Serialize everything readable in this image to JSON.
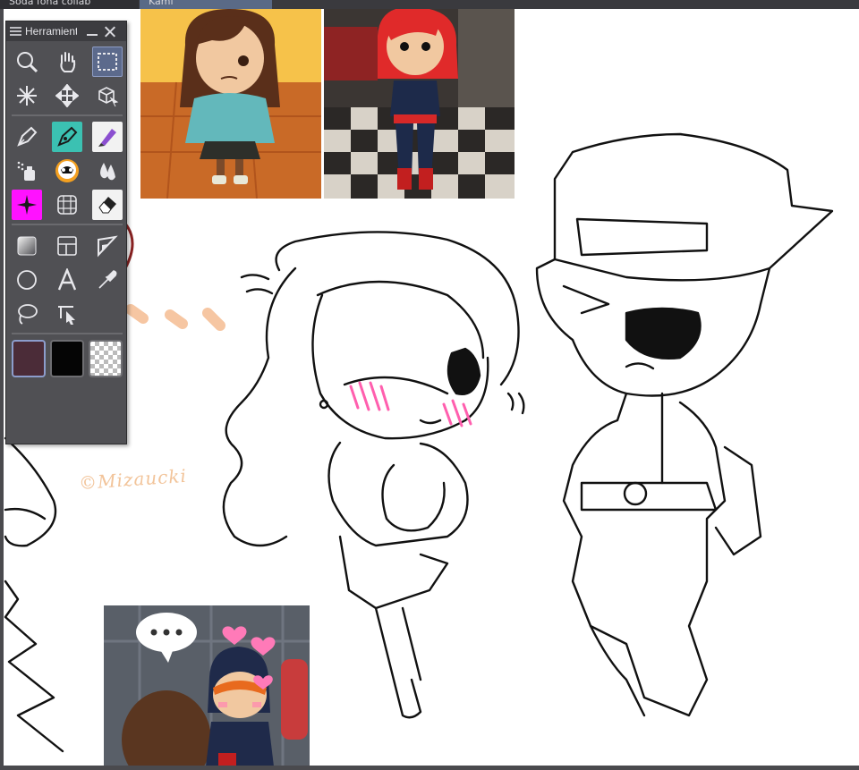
{
  "tabs": [
    {
      "label": "Soda fona collab"
    },
    {
      "label": "Kami"
    }
  ],
  "tool_palette": {
    "title": "Herramientas",
    "tools": [
      [
        {
          "icon": "zoom-icon"
        },
        {
          "icon": "hand-icon"
        },
        {
          "icon": "selection-icon",
          "active": true
        }
      ],
      [
        {
          "icon": "auto-select-icon"
        },
        {
          "icon": "move-icon"
        },
        {
          "icon": "object-icon"
        }
      ],
      [
        {
          "icon": "pen-icon"
        },
        {
          "icon": "marker-icon"
        },
        {
          "icon": "brush-icon"
        }
      ],
      [
        {
          "icon": "airbrush-icon"
        },
        {
          "icon": "decoration-icon"
        },
        {
          "icon": "blend-icon"
        }
      ],
      [
        {
          "icon": "sparkle-icon"
        },
        {
          "icon": "perspective-icon"
        },
        {
          "icon": "eraser-icon"
        }
      ],
      [
        {
          "icon": "gradient-icon"
        },
        {
          "icon": "frame-icon"
        },
        {
          "icon": "ruler-icon"
        }
      ],
      [
        {
          "icon": "figure-icon"
        },
        {
          "icon": "text-icon"
        },
        {
          "icon": "eyedropper-icon"
        }
      ],
      [
        {
          "icon": "lasso-icon"
        },
        {
          "icon": "correct-line-icon"
        }
      ]
    ],
    "colors": {
      "main": "#4b2c38",
      "sub": "#050505",
      "accent": "#5c6a8c"
    }
  },
  "canvas": {
    "signature": "©Mizaucki"
  }
}
